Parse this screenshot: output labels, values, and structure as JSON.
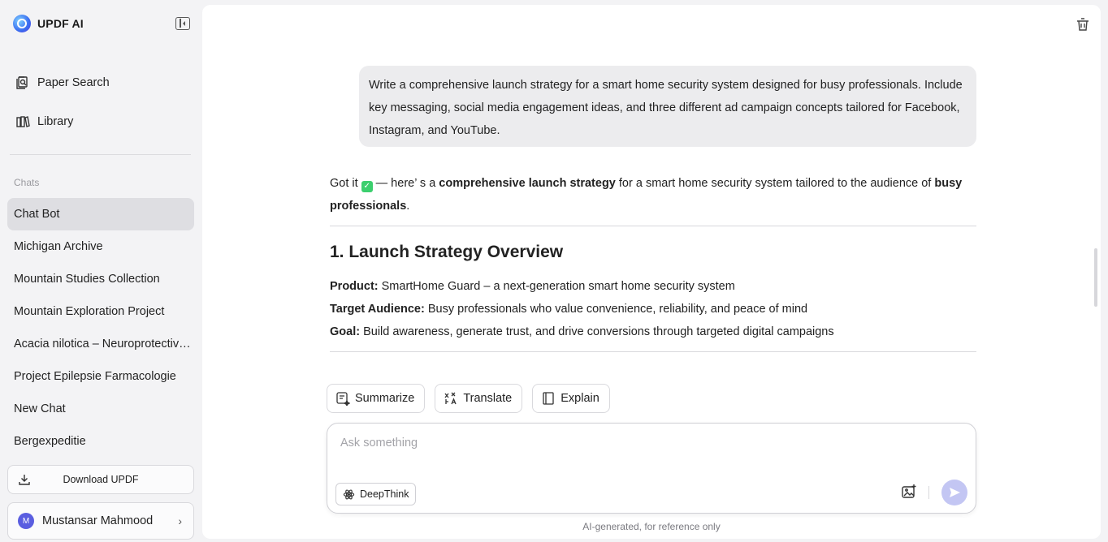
{
  "app": {
    "name": "UPDF AI"
  },
  "nav": {
    "paper_search": "Paper Search",
    "library": "Library"
  },
  "chats": {
    "label": "Chats",
    "items": [
      {
        "title": "Chat Bot",
        "active": true
      },
      {
        "title": "Michigan Archive"
      },
      {
        "title": "Mountain Studies Collection"
      },
      {
        "title": "Mountain Exploration Project"
      },
      {
        "title": "Acacia nilotica – Neuroprotective Effects"
      },
      {
        "title": "Project Epilepsie Farmacologie"
      },
      {
        "title": "New Chat"
      },
      {
        "title": "Bergexpeditie"
      }
    ]
  },
  "download": {
    "label": "Download UPDF"
  },
  "user": {
    "initial": "M",
    "name": "Mustansar Mahmood"
  },
  "conversation": {
    "user_message": "Write a comprehensive launch strategy for a smart home security system designed for busy professionals. Include key messaging, social media engagement ideas, and three different ad campaign concepts tailored for Facebook, Instagram, and YouTube.",
    "answer": {
      "intro_pre": "Got it",
      "intro_mid": "— here’ s a",
      "intro_bold1": "comprehensive launch strategy",
      "intro_post": "for a smart home security system tailored to the audience of",
      "intro_bold2": "busy professionals",
      "intro_end": ".",
      "heading": "1. Launch Strategy Overview",
      "details": [
        {
          "label": "Product:",
          "text": "SmartHome Guard – a next-generation smart home security system"
        },
        {
          "label": "Target Audience:",
          "text": "Busy professionals who value convenience, reliability, and peace of mind"
        },
        {
          "label": "Goal:",
          "text": "Build awareness, generate trust, and drive conversions through targeted digital campaigns"
        }
      ]
    }
  },
  "quick_actions": {
    "summarize": "Summarize",
    "translate": "Translate",
    "explain": "Explain"
  },
  "composer": {
    "placeholder": "Ask something",
    "deepthink": "DeepThink"
  },
  "footnote": "AI-generated, for reference only",
  "colors": {
    "accent": "#5a5ee0",
    "send_disabled": "#c3c6f3",
    "check": "#3ccf6e"
  }
}
